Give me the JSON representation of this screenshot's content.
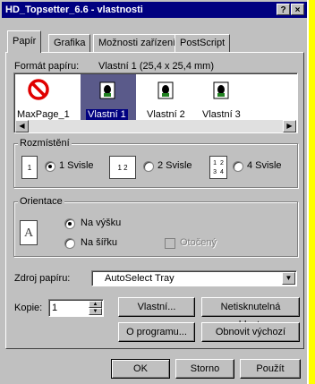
{
  "window": {
    "title": "HD_Topsetter_6.6 - vlastnosti",
    "help_btn": "?",
    "close_btn": "×"
  },
  "tabs": [
    {
      "label": "Papír"
    },
    {
      "label": "Grafika"
    },
    {
      "label": "Možnosti zařízení"
    },
    {
      "label": "PostScript"
    }
  ],
  "paper": {
    "label": "Formát papíru:",
    "value": "Vlastní 1 (25,4 x 25,4 mm)",
    "items": [
      {
        "label": "MaxPage_1",
        "icon": "no-entry-icon"
      },
      {
        "label": "Vlastní 1",
        "icon": "custom-paper-icon",
        "selected": true
      },
      {
        "label": "Vlastní 2",
        "icon": "custom-paper-icon"
      },
      {
        "label": "Vlastní 3",
        "icon": "custom-paper-icon"
      }
    ]
  },
  "layout": {
    "title": "Rozmístění",
    "options": [
      {
        "label": "1 Svisle",
        "icon_text": "1",
        "checked": true
      },
      {
        "label": "2 Svisle",
        "icon_text": "1 2",
        "checked": false
      },
      {
        "label": "4 Svisle",
        "icon_text": "1 2 3 4",
        "checked": false
      }
    ]
  },
  "orientation": {
    "title": "Orientace",
    "icon_letter": "A",
    "portrait": "Na výšku",
    "landscape": "Na šířku",
    "rotated": "Otočený"
  },
  "source": {
    "label": "Zdroj papíru:",
    "value": "AutoSelect Tray"
  },
  "copies": {
    "label": "Kopie:",
    "value": "1"
  },
  "buttons": {
    "custom": "Vlastní...",
    "unprintable": "Netiskn­utelná oblast...",
    "about": "O programu...",
    "restore": "Obnovit výchozí",
    "ok": "OK",
    "cancel": "Storno",
    "apply": "Použít"
  }
}
